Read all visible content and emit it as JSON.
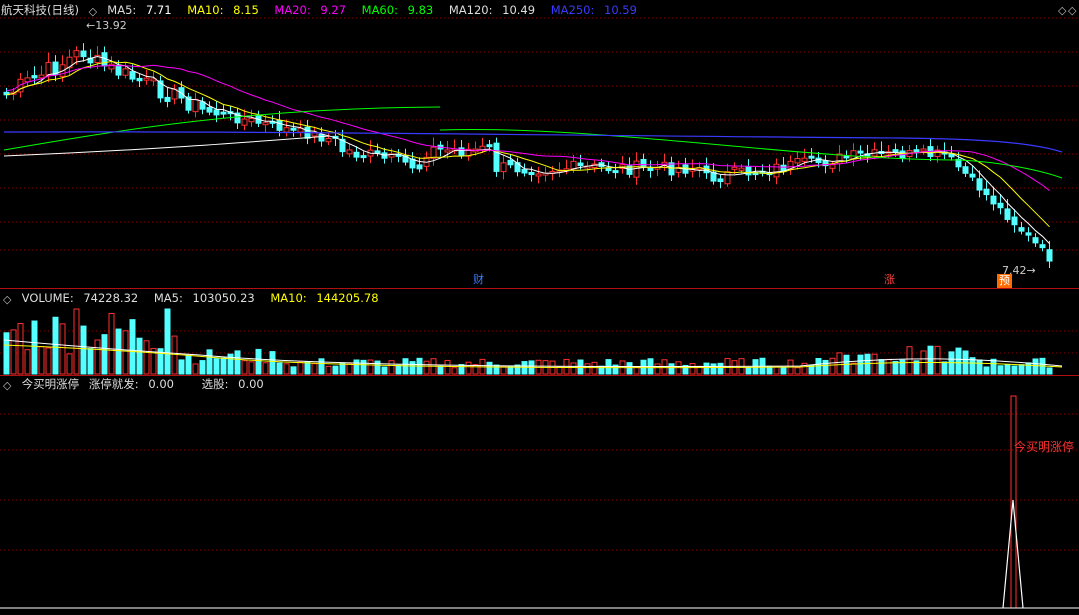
{
  "main_panel": {
    "stock_name": "航天科技",
    "period": "(日线)",
    "indicators": [
      {
        "label": "MA5:",
        "value": "7.71",
        "color": "#ffffff"
      },
      {
        "label": "MA10:",
        "value": "8.15",
        "color": "#ffff00"
      },
      {
        "label": "MA20:",
        "value": "9.27",
        "color": "#ff00ff"
      },
      {
        "label": "MA60:",
        "value": "9.83",
        "color": "#00ff00"
      },
      {
        "label": "MA120:",
        "value": "10.49",
        "color": "#ffffff"
      },
      {
        "label": "MA250:",
        "value": "10.59",
        "color": "#3030ff"
      }
    ],
    "high_marker": "13.92",
    "low_marker": "7.42",
    "event_marks": [
      {
        "text": "财",
        "color": "#3a78ff"
      },
      {
        "text": "涨",
        "color": "#ff4040"
      },
      {
        "text": "预",
        "color": "#ffffff",
        "bg": "#ff6a00"
      }
    ]
  },
  "volume_panel": {
    "title": "VOLUME:",
    "value": "74228.32",
    "ma5_label": "MA5:",
    "ma5_value": "103050.23",
    "ma10_label": "MA10:",
    "ma10_value": "144205.78"
  },
  "signal_panel": {
    "title": "今买明涨停",
    "param1_label": "涨停就发:",
    "param1_value": "0.00",
    "param2_label": "选股:",
    "param2_value": "0.00",
    "signal_text": "今买明涨停"
  },
  "colors": {
    "up": "#ff3030",
    "down": "#54ffff",
    "grid": "#8b0000",
    "separator": "#b01010"
  },
  "icons": [
    "diamond-icon"
  ]
}
